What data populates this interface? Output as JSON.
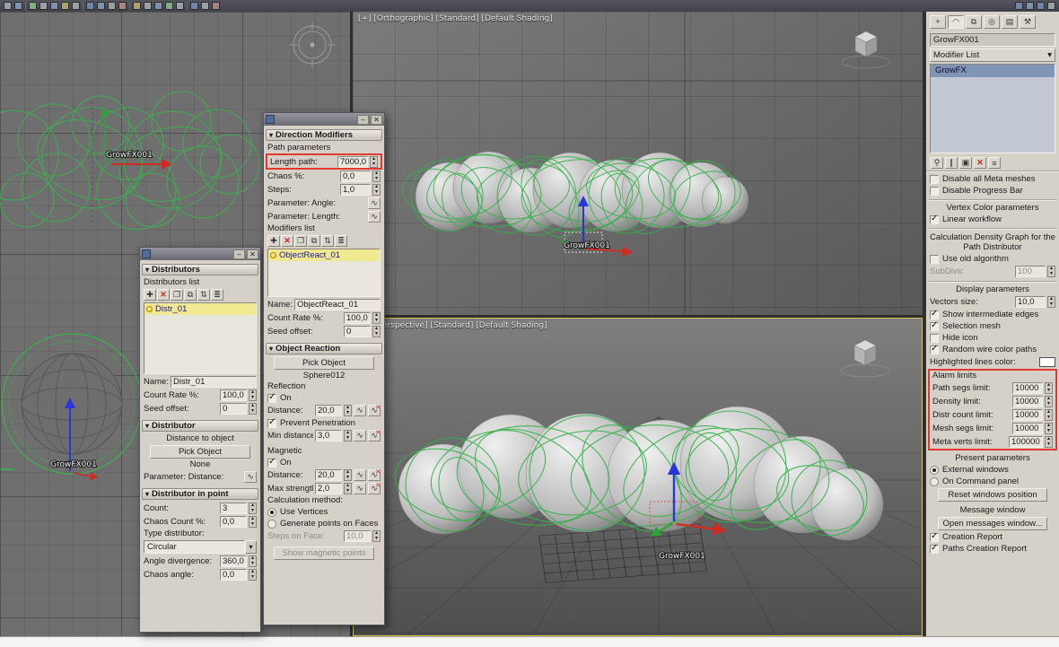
{
  "toolbar": {
    "icons": [
      "select-object",
      "select-by-name",
      "rectangular-selection",
      "move",
      "rotate",
      "scale",
      "snap-toggle",
      "angle-snap",
      "mirror",
      "align",
      "layer-manager",
      "curve-editor",
      "schematic-view",
      "material-editor",
      "render-setup",
      "rendered-frame",
      "render-production"
    ]
  },
  "viewports": {
    "ortho": {
      "label": "[+] [Orthographic] [Standard] [Default Shading]",
      "object_label": "GrowFX001"
    },
    "persp": {
      "label": "[+] [Perspective] [Standard] [Default Shading]",
      "object_label": "GrowFX001"
    },
    "left": {
      "object_label_top": "GrowFX001",
      "object_label_bottom": "GrowFX001"
    },
    "wire_color": "#3bb24d"
  },
  "command_panel": {
    "object_name": "GrowFX001",
    "modifier_list": "Modifier List",
    "stack_item": "GrowFX",
    "rows": {
      "disable_meta": {
        "label": "Disable all Meta meshes",
        "checked": false
      },
      "disable_progress": {
        "label": "Disable Progress Bar",
        "checked": false
      },
      "vertex_color_section": "Vertex Color parameters",
      "linear_workflow": {
        "label": "Linear workflow",
        "checked": true
      },
      "calc_density_section": "Calculation Density Graph for the Path Distributor",
      "use_old": {
        "label": "Use old algorithm",
        "checked": false
      },
      "subdivs": {
        "label": "SubDivs:",
        "value": "100"
      },
      "display_section": "Display parameters",
      "vectors_size": {
        "label": "Vectors size:",
        "value": "10,0"
      },
      "show_edges": {
        "label": "Show intermediate edges",
        "checked": true
      },
      "selection_mesh": {
        "label": "Selection mesh",
        "checked": true
      },
      "hide_icon": {
        "label": "Hide icon",
        "checked": false
      },
      "random_wire": {
        "label": "Random wire color paths",
        "checked": true
      },
      "highlight_color": "Highlighted lines color:",
      "alarm": {
        "title": "Alarm limits",
        "path_segs": {
          "label": "Path segs limit:",
          "value": "10000"
        },
        "density": {
          "label": "Density limit:",
          "value": "10000"
        },
        "distr_count": {
          "label": "Distr count limit:",
          "value": "10000"
        },
        "mesh_segs": {
          "label": "Mesh segs limit:",
          "value": "10000"
        },
        "meta_verts": {
          "label": "Meta verts limit:",
          "value": "100000"
        }
      },
      "present_section": "Present parameters",
      "external_windows": {
        "label": "External windows",
        "checked": true
      },
      "on_command_panel": {
        "label": "On Command panel",
        "checked": false
      },
      "reset_btn": "Reset windows position",
      "message_section": "Message window",
      "open_messages_btn": "Open messages window...",
      "creation_report": {
        "label": "Creation Report",
        "checked": true
      },
      "paths_creation_report": {
        "label": "Paths Creation Report",
        "checked": true
      }
    }
  },
  "direction_modifiers": {
    "rollout": "Direction Modifiers",
    "path_params_label": "Path parameters",
    "length_path": {
      "label": "Length path:",
      "value": "7000,0"
    },
    "chaos": {
      "label": "Chaos %:",
      "value": "0,0"
    },
    "steps": {
      "label": "Steps:",
      "value": "1,0"
    },
    "param_angle": "Parameter: Angle:",
    "param_length": "Parameter: Length:",
    "modifiers_list_label": "Modifiers list",
    "item": "ObjectReact_01",
    "name": {
      "label": "Name:",
      "value": "ObjectReact_01"
    },
    "count_rate": {
      "label": "Count Rate %:",
      "value": "100,0"
    },
    "seed_offset": {
      "label": "Seed offset:",
      "value": "0"
    },
    "object_reaction": {
      "rollout": "Object Reaction",
      "pick_btn": "Pick Object",
      "picked": "Sphere012",
      "reflection_label": "Reflection",
      "on": {
        "label": "On",
        "checked": true
      },
      "distance": {
        "label": "Distance:",
        "value": "20,0"
      },
      "prevent": {
        "label": "Prevent Penetration",
        "checked": true
      },
      "min_distance": {
        "label": "Min distance:",
        "value": "3,0"
      },
      "magnetic_label": "Magnetic",
      "mag_on": {
        "label": "On",
        "checked": true
      },
      "mag_distance": {
        "label": "Distance:",
        "value": "20,0"
      },
      "max_strength": {
        "label": "Max strength %",
        "value": "2,0"
      },
      "calc_label": "Calculation method:",
      "use_vertices": {
        "label": "Use Vertices",
        "checked": true
      },
      "gen_points": {
        "label": "Generate points on Faces",
        "checked": false
      },
      "steps_on_face": {
        "label": "Steps on Face:",
        "value": "10,0"
      },
      "show_magnetic": "Show magnetic points"
    }
  },
  "distributors": {
    "rollout": "Distributors",
    "list_label": "Distributors list",
    "item": "Distr_01",
    "name": {
      "label": "Name:",
      "value": "Distr_01"
    },
    "count_rate": {
      "label": "Count Rate %:",
      "value": "100,0"
    },
    "seed_offset": {
      "label": "Seed offset:",
      "value": "0"
    },
    "distributor": {
      "rollout": "Distributor",
      "type_label": "Distance to object",
      "pick_btn": "Pick Object",
      "picked": "None",
      "param_distance": "Parameter: Distance:"
    },
    "in_point": {
      "rollout": "Distributor in point",
      "count": {
        "label": "Count:",
        "value": "3"
      },
      "chaos_count": {
        "label": "Chaos Count %:",
        "value": "0,0"
      },
      "type_label": "Type distributor:",
      "type_value": "Circular",
      "angle_divergence": {
        "label": "Angle divergence:",
        "value": "360,0"
      },
      "chaos_angle": {
        "label": "Chaos angle:",
        "value": "0,0"
      }
    }
  },
  "icons": {
    "close": "✕",
    "minimize": "–",
    "dropdown": "▾",
    "add": "✚",
    "del": "✕",
    "clone": "❐",
    "copy": "⧉",
    "updown": "⇅",
    "menu": "≣",
    "curve": "∿",
    "pin": "⚲",
    "pipe": "∥",
    "unique": "▣",
    "remove": "✕",
    "config": "≡",
    "tab_create": "+",
    "tab_modify": "◠",
    "tab_hierarchy": "⧉",
    "tab_motion": "◎",
    "tab_display": "▤",
    "tab_utils": "⚒"
  }
}
